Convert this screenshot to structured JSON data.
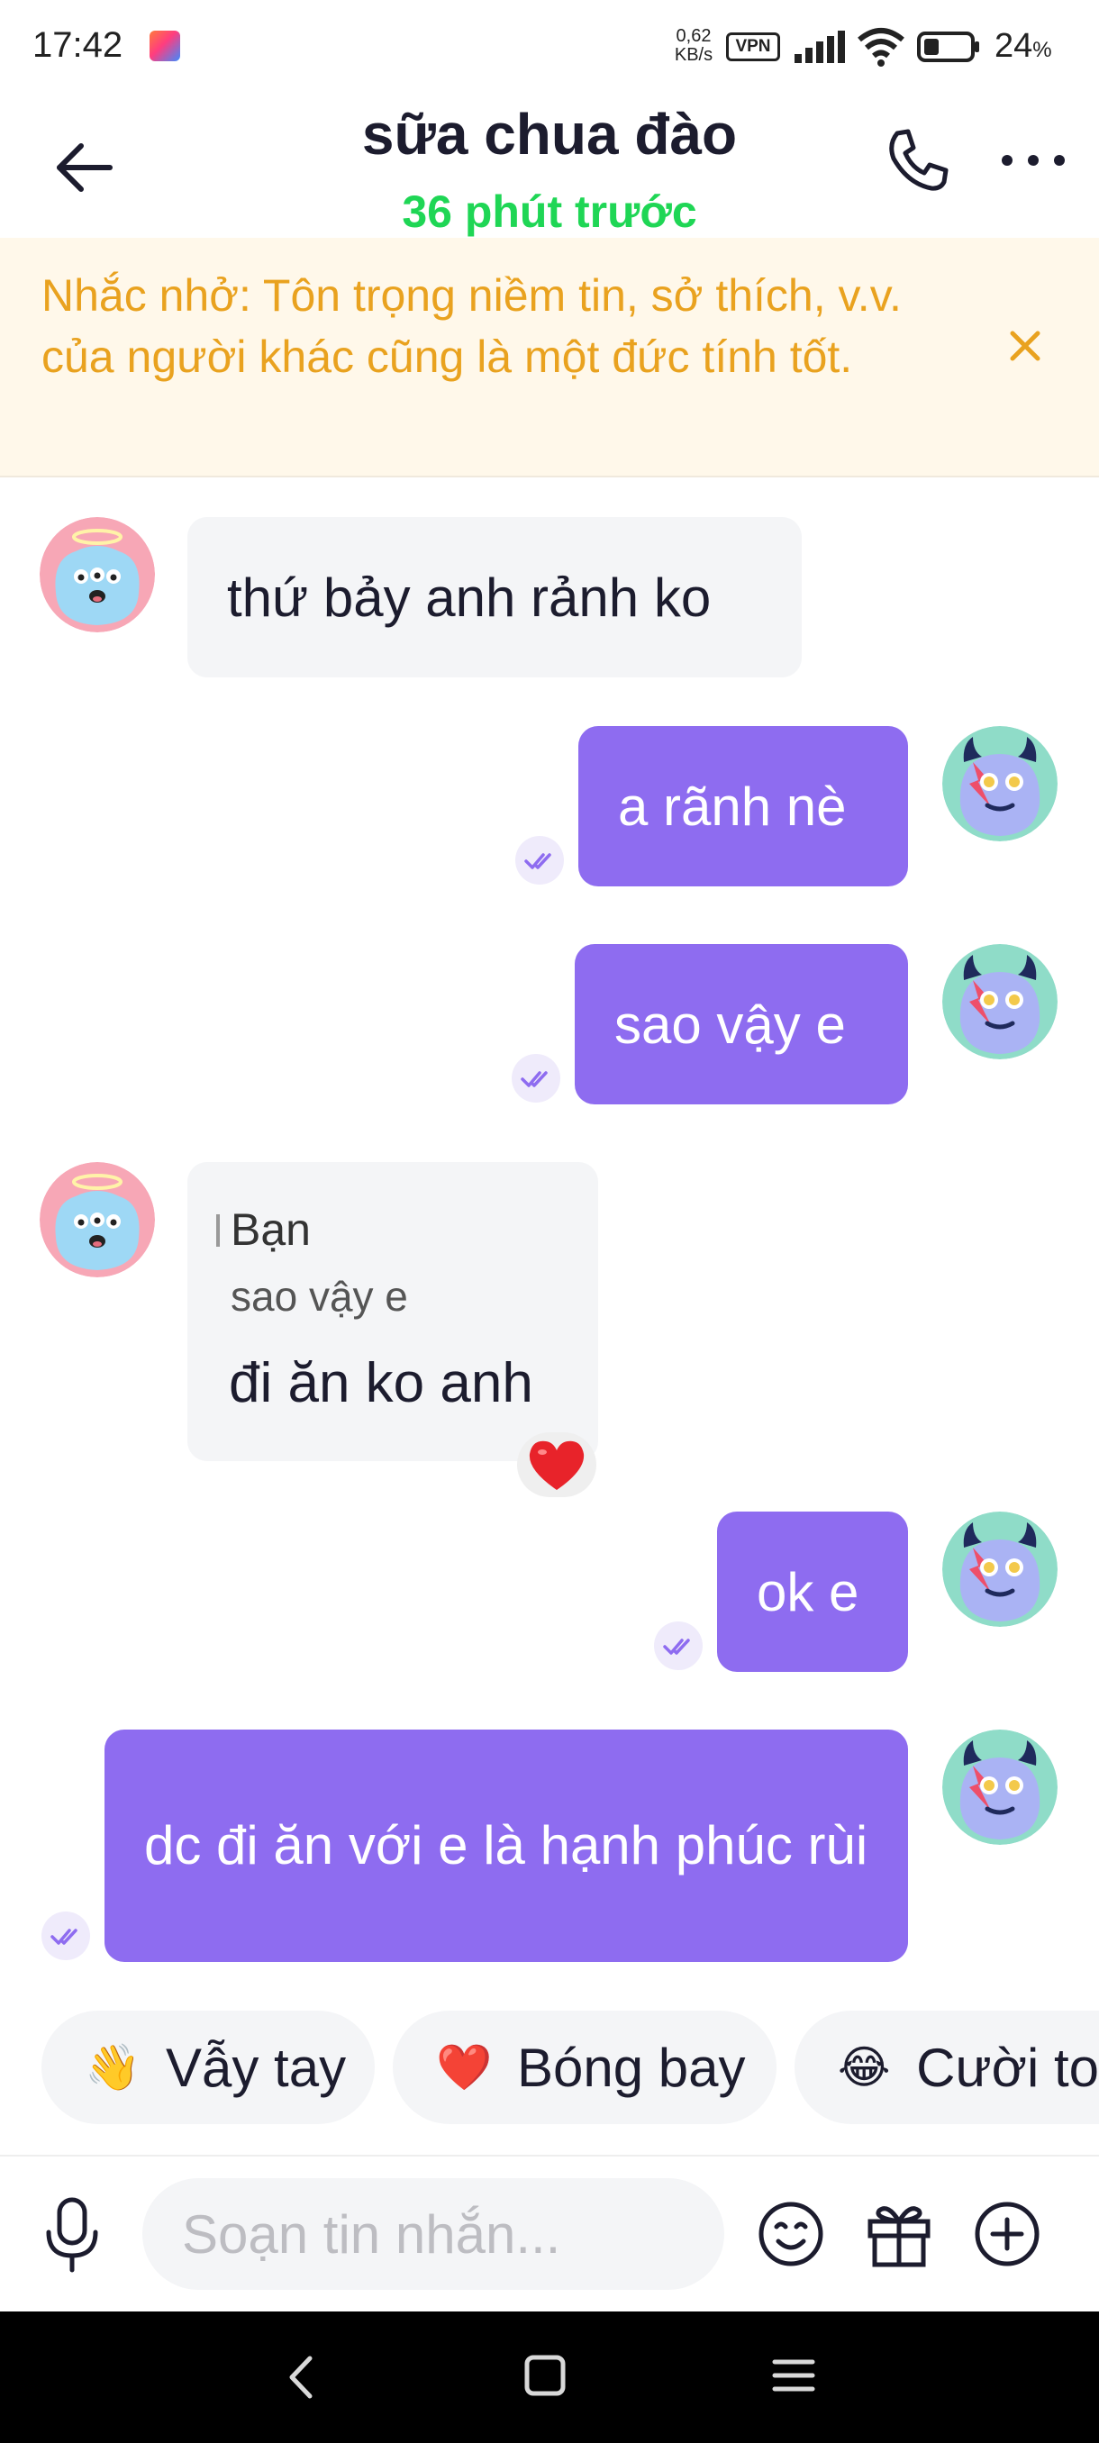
{
  "status_bar": {
    "time": "17:42",
    "net_speed_value": "0,62",
    "net_speed_unit": "KB/s",
    "vpn_label": "VPN",
    "battery_value": "24",
    "battery_unit": "%"
  },
  "header": {
    "contact_name": "sữa chua đào",
    "last_seen": "36 phút trước"
  },
  "reminder": {
    "text": "Nhắc nhở: Tôn trọng niềm tin, sở thích, v.v. của người khác cũng là một đức tính tốt.",
    "close_glyph": "×"
  },
  "messages": [
    {
      "side": "in",
      "text": "thứ bảy anh rảnh ko"
    },
    {
      "side": "out",
      "text": "a rãnh nè",
      "status": "read"
    },
    {
      "side": "out",
      "text": "sao vậy e",
      "status": "read"
    },
    {
      "side": "in",
      "quote_sender": "Bạn",
      "quote_text": "sao vậy e",
      "text": "đi ăn ko anh",
      "reaction": "❤️"
    },
    {
      "side": "out",
      "text": "ok e",
      "status": "read"
    },
    {
      "side": "out",
      "text": "dc đi ăn với e là hạnh phúc rùi",
      "status": "read"
    }
  ],
  "quick_replies": [
    {
      "emoji": "👋",
      "label": "Vẫy tay"
    },
    {
      "emoji": "❤️",
      "label": "Bóng bay"
    },
    {
      "emoji": "😂",
      "label": "Cười to"
    }
  ],
  "input": {
    "placeholder": "Soạn tin nhắn..."
  },
  "colors": {
    "accent": "#8e6cf0",
    "online": "#1fd655",
    "reminder_text": "#e9a21f",
    "reminder_bg": "#fff8ea"
  },
  "icons": {
    "back": "arrow-left-icon",
    "call": "phone-icon",
    "more": "more-horizontal-icon",
    "mic": "microphone-icon",
    "emoji": "emoji-icon",
    "gift": "gift-icon",
    "plus": "plus-circle-icon",
    "read": "double-check-icon"
  }
}
